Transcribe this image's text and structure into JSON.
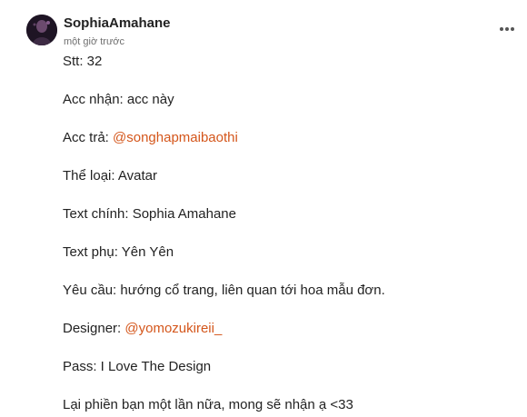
{
  "comment": {
    "author": "SophiaAmahane",
    "timestamp": "một giờ trước",
    "more_icon": "more-dots-icon",
    "accent_color": "#d4561b",
    "lines": [
      {
        "label": "Stt: 32",
        "mention": ""
      },
      {
        "label": "Acc nhận: acc này",
        "mention": ""
      },
      {
        "label": "Acc trả: ",
        "mention": "@songhapmaibaothi"
      },
      {
        "label": "Thể loại: Avatar",
        "mention": ""
      },
      {
        "label": "Text chính: Sophia Amahane",
        "mention": ""
      },
      {
        "label": "Text phụ: Yên Yên",
        "mention": ""
      },
      {
        "label": "Yêu cầu: hướng cổ trang, liên quan tới hoa mẫu đơn.",
        "mention": ""
      },
      {
        "label": "Designer: ",
        "mention": "@yomozukireii_"
      },
      {
        "label": "Pass: I Love The Design",
        "mention": ""
      },
      {
        "label": "Lại phiền bạn một lần nữa, mong sẽ nhận ạ <33",
        "mention": ""
      }
    ]
  }
}
